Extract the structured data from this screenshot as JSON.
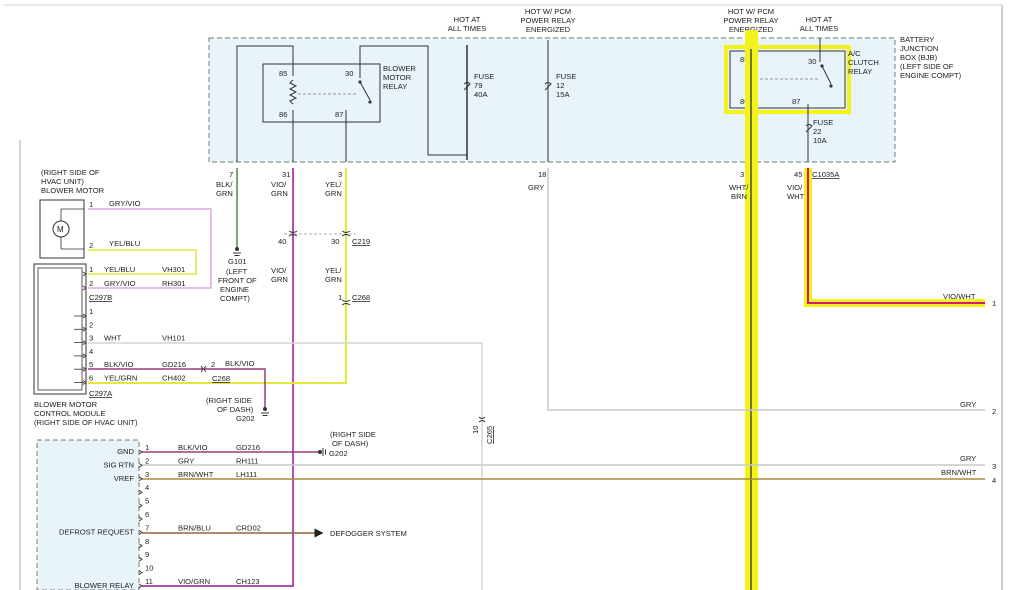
{
  "bjb": {
    "title_lines": [
      "BATTERY",
      "JUNCTION",
      "BOX (BJB)",
      "(LEFT SIDE OF",
      "ENGINE COMPT)"
    ],
    "hot_at_all_times_lines": [
      "HOT AT",
      "ALL TIMES"
    ],
    "hot_pcm_lines": [
      "HOT W/ PCM",
      "POWER RELAY",
      "ENERGIZED"
    ],
    "blower_relay_lines": [
      "BLOWER",
      "MOTOR",
      "RELAY"
    ],
    "ac_relay_lines": [
      "A/C",
      "CLUTCH",
      "RELAY"
    ],
    "fuse_79": [
      "FUSE",
      "79",
      "40A"
    ],
    "fuse_12": [
      "FUSE",
      "12",
      "15A"
    ],
    "fuse_22": [
      "FUSE",
      "22",
      "10A"
    ],
    "relay_pins": {
      "p85": "85",
      "p86": "86",
      "p30": "30",
      "p87": "87"
    },
    "pins": {
      "p7": "7",
      "p31": "31",
      "p3": "3",
      "p18": "18",
      "p37": "37",
      "p45": "45"
    },
    "c1035a": "C1035A"
  },
  "wires": {
    "blk_grn": [
      "BLK/",
      "GRN"
    ],
    "vio_grn": [
      "VIO/",
      "GRN"
    ],
    "yel_grn": [
      "YEL/",
      "GRN"
    ],
    "gry": "GRY",
    "wht_brn": [
      "WHT/",
      "BRN"
    ],
    "vio_wht": [
      "VIO/",
      "WHT"
    ],
    "vio_wht_run": "VIO/WHT",
    "gry_run": "GRY",
    "gry_run2": "GRY",
    "brn_wht_run": "BRN/WHT"
  },
  "ground_g101": {
    "name": "G101",
    "lines": [
      "(LEFT",
      "FRONT OF",
      "ENGINE",
      "COMPT)"
    ]
  },
  "ground_g202a": {
    "name": "G202",
    "lines": [
      "(RIGHT SIDE",
      "OF DASH)"
    ]
  },
  "ground_g202b": {
    "name": "G202",
    "lines": [
      "(RIGHT SIDE",
      "OF DASH)"
    ]
  },
  "inline": {
    "c219": "C219",
    "p40": "40",
    "p30": "30",
    "c268": "C268",
    "p1": "1",
    "c265": "C265",
    "p10": "10",
    "c268b": "C268",
    "p2": "2"
  },
  "blower_motor": {
    "title_lines": [
      "(RIGHT SIDE OF",
      "HVAC UNIT)",
      "BLOWER MOTOR"
    ],
    "pin1": "1",
    "pin1_wire": "GRY/VIO",
    "pin2": "2",
    "pin2_wire": "YEL/BLU"
  },
  "bmcm": {
    "title_lines": [
      "BLOWER MOTOR",
      "CONTROL MODULE",
      "(RIGHT SIDE OF HVAC UNIT)"
    ],
    "c297b": "C297B",
    "c297a": "C297A",
    "pins_b": [
      {
        "pin": "1",
        "wire": "YEL/BLU",
        "circuit": "VH301"
      },
      {
        "pin": "2",
        "wire": "GRY/VIO",
        "circuit": "RH301"
      }
    ],
    "pins_a": [
      {
        "pin": "1",
        "wire": "",
        "circuit": ""
      },
      {
        "pin": "2",
        "wire": "",
        "circuit": ""
      },
      {
        "pin": "3",
        "wire": "WHT",
        "circuit": "VH101"
      },
      {
        "pin": "4",
        "wire": "",
        "circuit": ""
      },
      {
        "pin": "5",
        "wire": "BLK/VIO",
        "circuit": "GD216"
      },
      {
        "pin": "6",
        "wire": "YEL/GRN",
        "circuit": "CH402"
      }
    ],
    "blk_vio_after": "BLK/VIO"
  },
  "module": {
    "pins": [
      {
        "pin": "1",
        "label": "GND",
        "wire": "BLK/VIO",
        "circuit": "GD216"
      },
      {
        "pin": "2",
        "label": "SIG RTN",
        "wire": "GRY",
        "circuit": "RH111"
      },
      {
        "pin": "3",
        "label": "VREF",
        "wire": "BRN/WHT",
        "circuit": "LH111"
      },
      {
        "pin": "4",
        "label": "",
        "wire": "",
        "circuit": ""
      },
      {
        "pin": "5",
        "label": "",
        "wire": "",
        "circuit": ""
      },
      {
        "pin": "6",
        "label": "",
        "wire": "",
        "circuit": ""
      },
      {
        "pin": "7",
        "label": "DEFROST REQUEST",
        "wire": "BRN/BLU",
        "circuit": "CRD02"
      },
      {
        "pin": "8",
        "label": "",
        "wire": "",
        "circuit": ""
      },
      {
        "pin": "9",
        "label": "",
        "wire": "",
        "circuit": ""
      },
      {
        "pin": "10",
        "label": "",
        "wire": "",
        "circuit": ""
      },
      {
        "pin": "11",
        "label": "BLOWER RELAY",
        "wire": "VIO/GRN",
        "circuit": "CH123"
      }
    ],
    "defogger": "DEFOGGER SYSTEM"
  },
  "right_edge": {
    "n1": "1",
    "n2": "2",
    "n3": "3",
    "n4": "4"
  },
  "colors": {
    "vio": "#b34fb3",
    "pink": "#e4a6e4",
    "yellow_grn": "#e2e838",
    "gry": "#c9c9c9",
    "gry_vio": "#d7a7d7",
    "blk_grn": "#4c8a4c",
    "highlight": "#f3f31a",
    "vio_wht": "#d9157a",
    "brn": "#a58b3a",
    "bjb_fill": "#e9f3fa",
    "dark": "#333333"
  }
}
